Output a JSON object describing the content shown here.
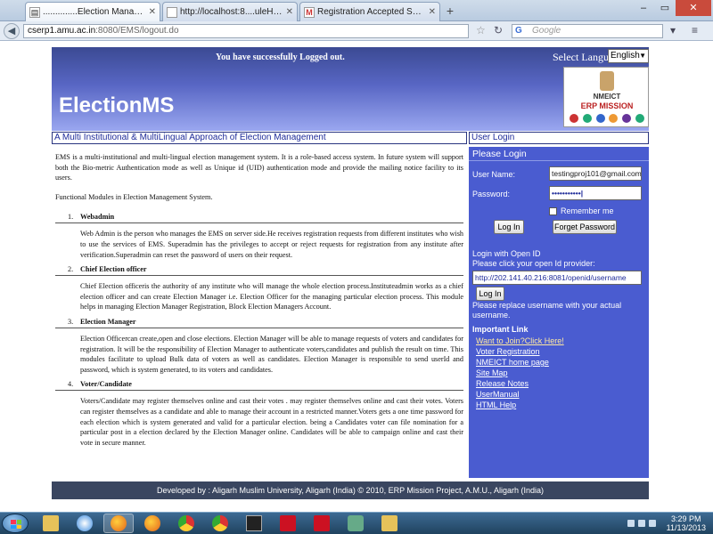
{
  "browser": {
    "tabs": [
      {
        "label": "..............Election Managment System....",
        "icon": "page-icon"
      },
      {
        "label": "http://localhost:8....uleHelp/index.html",
        "icon": "blank-page-icon"
      },
      {
        "label": "Registration Accepted Successfully fr...",
        "icon": "gmail-icon"
      }
    ],
    "url_host": "cserp1.amu.ac.in",
    "url_path": ":8080/EMS/logout.do",
    "search_placeholder": "Google",
    "search_engine": "G"
  },
  "page": {
    "logout_message": "You have successfully Logged out.",
    "language_label": "Select Language",
    "language_value": "English",
    "brand": "ElectionMS",
    "tagline": "A Multi Institutional & MultiLingual Approach of Election Management",
    "user_login_header": "User Login",
    "logo": {
      "line1": "NMEICT",
      "line2": "ERP MISSION"
    },
    "intro": "EMS is a multi-institutional and multi-lingual election management system. It is a role-based access system. In future system will support both the Bio-metric Authentication mode as well as Unique id (UID) authentication mode and provide the mailing notice facility to its users.",
    "modules_heading": "Functional Modules in Election Management System.",
    "modules": [
      {
        "num": "1.",
        "title": "Webadmin",
        "body": "Web Admin is the person who manages the EMS on server side.He receives registration requests from different institutes who wish to use the services of EMS. Superadmin has the privileges to accept or reject requests for registration from any institute after verification.Superadmin can reset the password of users on their request."
      },
      {
        "num": "2.",
        "title": "Chief Election officer",
        "body": "Chief Election officeris the authority of any institute who will manage the whole election process.Instituteadmin works as a chief election officer and can create Election Manager i.e. Election Officer for the managing particular election process. This module helps in managing Election Manager Registration, Block Election Managers Account."
      },
      {
        "num": "3.",
        "title": "Election Manager",
        "body": "Election Officercan create,open and close elections. Election Manager will be able to manage requests of voters and candidates for registration. It will be the responsibility of Election Manager to authenticate voters,candidates and publish the result on time. This modules facilitate to upload Bulk data of voters as well as candidates. Election Manager is responsible to send userId and password, which is system generated, to its voters and candidates."
      },
      {
        "num": "4.",
        "title": "Voter/Candidate",
        "body": "Voters/Candidate may register themselves online and cast their votes . may register themselves online and cast their votes. Voters can register themselves as a candidate and able to manage their account in a restricted manner.Voters gets a one time password for each election which is system generated and valid for a particular election. being a Candidates voter can file nomination for a particular post in a election declared by the Election Manager online. Candidates will be able to campaign online and cast their vote in secure manner."
      }
    ],
    "login": {
      "title": "Please Login",
      "user_label": "User Name:",
      "user_value": "testingproj101@gmail.com",
      "password_label": "Password:",
      "password_value": "•••••••••••|",
      "remember_label": "Remember me",
      "login_button": "Log In",
      "forget_button": "Forget Password",
      "openid_title": "Login with Open ID",
      "openid_prompt": "Please click your open Id provider:",
      "openid_value": "http://202.141.40.216:8081/openid/username",
      "openid_button": "Log In",
      "openid_note": "Please replace username with your actual username."
    },
    "important": {
      "title": "Important Link",
      "links": [
        "Want to Join?Click Here!",
        "Voter Registration",
        "NMEICT home page",
        "Site Map",
        "Release Notes",
        "UserManual",
        "HTML Help"
      ]
    },
    "footer": "Developed by : Aligarh Muslim University, Aligarh (India)   © 2010, ERP Mission Project, A.M.U., Aligarh (India)"
  },
  "taskbar": {
    "time": "3:29 PM",
    "date": "11/13/2013"
  }
}
